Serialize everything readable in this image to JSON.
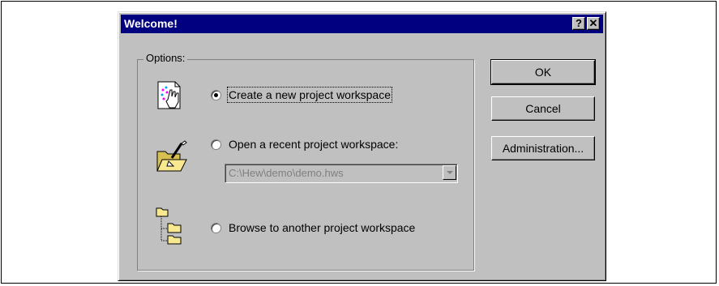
{
  "dialog": {
    "title": "Welcome!",
    "help_button": "?",
    "close_button": "✕"
  },
  "options": {
    "group_label": "Options:",
    "create_label": "Create a new project workspace",
    "open_label": "Open a recent project workspace:",
    "recent_value": "C:\\Hew\\demo\\demo.hws",
    "browse_label": "Browse to another project workspace",
    "selected": "create"
  },
  "buttons": {
    "ok": "OK",
    "cancel": "Cancel",
    "administration": "Administration..."
  },
  "colors": {
    "titlebar": "#000080",
    "face": "#c0c0c0"
  }
}
